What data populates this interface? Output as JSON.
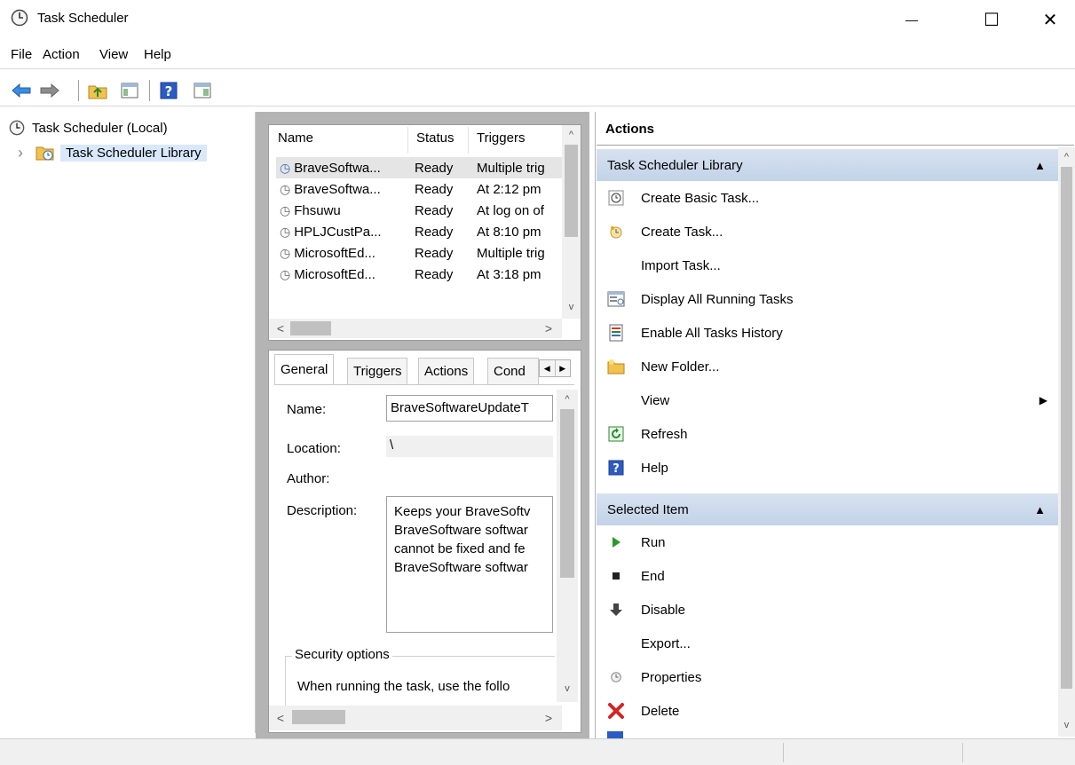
{
  "window": {
    "title": "Task Scheduler",
    "minimize_glyph": "—",
    "maximize_glyph": "☐",
    "close_glyph": "✕"
  },
  "menu": [
    "File",
    "Action",
    "View",
    "Help"
  ],
  "toolbar": {
    "icons": [
      "back-arrow-icon",
      "forward-arrow-icon",
      "up-folder-icon",
      "show-hide-console-tree-icon",
      "help-icon",
      "show-hide-action-pane-icon"
    ]
  },
  "tree": {
    "root": "Task Scheduler (Local)",
    "child": "Task Scheduler Library",
    "expand_glyph": "›"
  },
  "task_list": {
    "columns": [
      "Name",
      "Status",
      "Triggers"
    ],
    "rows": [
      {
        "name": "BraveSoftwa...",
        "status": "Ready",
        "triggers": "Multiple trig"
      },
      {
        "name": "BraveSoftwa...",
        "status": "Ready",
        "triggers": "At 2:12 pm"
      },
      {
        "name": "Fhsuwu",
        "status": "Ready",
        "triggers": "At log on of"
      },
      {
        "name": "HPLJCustPa...",
        "status": "Ready",
        "triggers": "At 8:10 pm"
      },
      {
        "name": "MicrosoftEd...",
        "status": "Ready",
        "triggers": "Multiple trig"
      },
      {
        "name": "MicrosoftEd...",
        "status": "Ready",
        "triggers": "At 3:18 pm"
      }
    ]
  },
  "detail": {
    "tabs": [
      "General",
      "Triggers",
      "Actions",
      "Cond"
    ],
    "name_label": "Name:",
    "name_value": "BraveSoftwareUpdateT",
    "location_label": "Location:",
    "location_value": "\\",
    "author_label": "Author:",
    "description_label": "Description:",
    "description_lines": [
      "Keeps your BraveSoftv",
      "BraveSoftware softwar",
      "cannot be fixed and fe",
      "BraveSoftware softwar"
    ],
    "security_group": "Security options",
    "security_text": "When running the task, use the follo"
  },
  "actions": {
    "header": "Actions",
    "sections": [
      {
        "title": "Task Scheduler Library",
        "items": [
          {
            "label": "Create Basic Task...",
            "icon": "create-basic-task-icon"
          },
          {
            "label": "Create Task...",
            "icon": "create-task-icon"
          },
          {
            "label": "Import Task...",
            "icon": ""
          },
          {
            "label": "Display All Running Tasks",
            "icon": "running-tasks-icon"
          },
          {
            "label": "Enable All Tasks History",
            "icon": "history-icon"
          },
          {
            "label": "New Folder...",
            "icon": "new-folder-icon"
          },
          {
            "label": "View",
            "icon": ""
          },
          {
            "label": "Refresh",
            "icon": "refresh-icon"
          },
          {
            "label": "Help",
            "icon": "help-icon"
          }
        ]
      },
      {
        "title": "Selected Item",
        "items": [
          {
            "label": "Run",
            "icon": "run-icon"
          },
          {
            "label": "End",
            "icon": "end-icon"
          },
          {
            "label": "Disable",
            "icon": "disable-icon"
          },
          {
            "label": "Export...",
            "icon": ""
          },
          {
            "label": "Properties",
            "icon": "properties-icon"
          },
          {
            "label": "Delete",
            "icon": "delete-icon"
          }
        ]
      }
    ]
  },
  "colors": {
    "section_header": "#c9d8ec",
    "selected_row": "#e5e5e5",
    "pane_border": "#b4b4b4"
  }
}
